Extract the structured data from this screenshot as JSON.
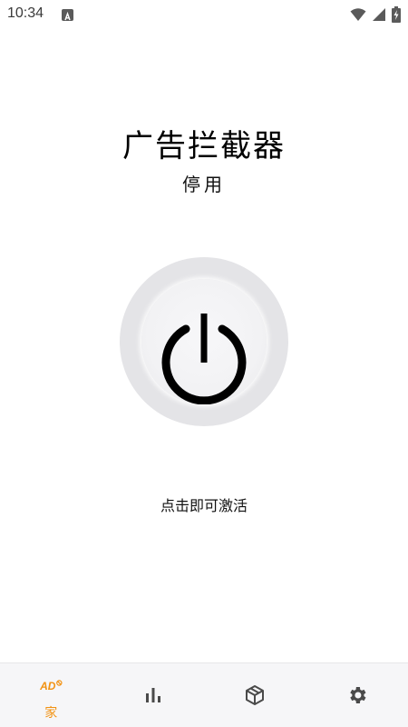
{
  "status_bar": {
    "time": "10:34",
    "icons": [
      "a-notification-icon",
      "wifi-icon",
      "signal-icon",
      "battery-charging-icon"
    ]
  },
  "header": {
    "title": "广告拦截器",
    "status": "停用"
  },
  "power_button": {
    "icon": "power-icon",
    "hint": "点击即可激活"
  },
  "bottom_nav": {
    "items": [
      {
        "id": "home",
        "icon": "ad-block-icon",
        "icon_text": "AD",
        "label": "家",
        "active": true
      },
      {
        "id": "stats",
        "icon": "bar-chart-icon",
        "label": "",
        "active": false
      },
      {
        "id": "filters",
        "icon": "cube-icon",
        "label": "",
        "active": false
      },
      {
        "id": "settings",
        "icon": "gear-icon",
        "label": "",
        "active": false
      }
    ],
    "accent_color": "#f29212",
    "inactive_color": "#4a4a4a"
  }
}
